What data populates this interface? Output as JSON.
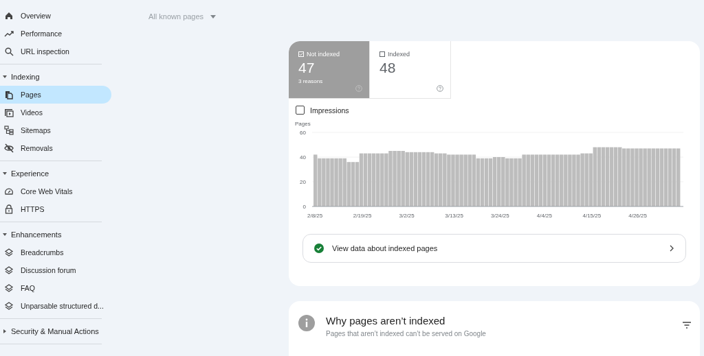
{
  "sidebar": {
    "items": [
      {
        "kind": "link",
        "label": "Overview",
        "selected": false
      },
      {
        "kind": "link",
        "label": "Performance",
        "selected": false
      },
      {
        "kind": "link",
        "label": "URL inspection",
        "selected": false
      },
      {
        "kind": "divider"
      },
      {
        "kind": "section",
        "label": "Indexing",
        "expanded": true
      },
      {
        "kind": "link",
        "label": "Pages",
        "selected": true
      },
      {
        "kind": "link",
        "label": "Videos",
        "selected": false
      },
      {
        "kind": "link",
        "label": "Sitemaps",
        "selected": false
      },
      {
        "kind": "link",
        "label": "Removals",
        "selected": false
      },
      {
        "kind": "divider"
      },
      {
        "kind": "section",
        "label": "Experience",
        "expanded": true
      },
      {
        "kind": "link",
        "label": "Core Web Vitals",
        "selected": false
      },
      {
        "kind": "link",
        "label": "HTTPS",
        "selected": false
      },
      {
        "kind": "divider"
      },
      {
        "kind": "section",
        "label": "Enhancements",
        "expanded": true
      },
      {
        "kind": "link",
        "label": "Breadcrumbs",
        "selected": false
      },
      {
        "kind": "link",
        "label": "Discussion forum",
        "selected": false
      },
      {
        "kind": "link",
        "label": "FAQ",
        "selected": false
      },
      {
        "kind": "link",
        "label": "Unparsable structured d...",
        "selected": false
      },
      {
        "kind": "divider"
      },
      {
        "kind": "section",
        "label": "Security & Manual Actions",
        "expanded": false
      },
      {
        "kind": "divider"
      }
    ]
  },
  "filter": {
    "value": "All known pages"
  },
  "summary": {
    "tabs": [
      {
        "label": "Not indexed",
        "count": "47",
        "note": "3 reasons",
        "selected": true,
        "checked": true
      },
      {
        "label": "Indexed",
        "count": "48",
        "selected": false,
        "checked": false
      }
    ],
    "impressions": {
      "label": "Impressions",
      "checked": false
    },
    "chart_data": {
      "type": "bar",
      "ylabel": "Pages",
      "ylim": [
        0,
        60
      ],
      "yticks": [
        0,
        20,
        40,
        60
      ],
      "categories": [
        "2/8/25",
        null,
        null,
        null,
        null,
        null,
        null,
        null,
        null,
        null,
        null,
        "2/19/25",
        null,
        null,
        null,
        null,
        null,
        null,
        null,
        null,
        null,
        null,
        "3/2/25",
        null,
        null,
        null,
        null,
        null,
        null,
        null,
        null,
        null,
        null,
        "3/13/25",
        null,
        null,
        null,
        null,
        null,
        null,
        null,
        null,
        null,
        null,
        "3/24/25",
        null,
        null,
        null,
        null,
        null,
        null,
        null,
        null,
        null,
        null,
        "4/4/25",
        null,
        null,
        null,
        null,
        null,
        null,
        null,
        null,
        null,
        null,
        "4/15/25",
        null,
        null,
        null,
        null,
        null,
        null,
        null,
        null,
        null,
        null,
        "4/26/25",
        null,
        null,
        null,
        null,
        null,
        null,
        null,
        null,
        null,
        null
      ],
      "series": [
        {
          "color": "#bdbdbd",
          "values": [
            42,
            39,
            39,
            39,
            39,
            39,
            39,
            39,
            36,
            36,
            36,
            43,
            43,
            43,
            43,
            43,
            43,
            43,
            45,
            45,
            45,
            45,
            44,
            44,
            44,
            44,
            44,
            44,
            44,
            43,
            43,
            43,
            42,
            42,
            42,
            42,
            42,
            42,
            42,
            39,
            39,
            39,
            39,
            40,
            40,
            40,
            39,
            39,
            39,
            39,
            42,
            42,
            42,
            42,
            42,
            42,
            42,
            42,
            42,
            42,
            42,
            42,
            42,
            42,
            43,
            43,
            43,
            48,
            48,
            48,
            48,
            48,
            48,
            48,
            47,
            47,
            47,
            47,
            47,
            47,
            47,
            47,
            47,
            47,
            47,
            47,
            47,
            47
          ]
        }
      ]
    },
    "link": {
      "label": "View data about indexed pages",
      "done": true
    }
  },
  "reasons": {
    "title": "Why pages aren’t indexed",
    "subtitle": "Pages that aren’t indexed can’t be served on Google"
  }
}
